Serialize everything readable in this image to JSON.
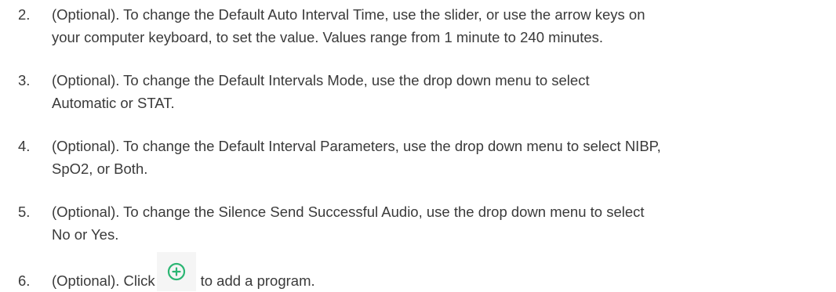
{
  "steps": [
    {
      "number": "2.",
      "lines": [
        "(Optional). To change the Default Auto Interval Time, use the slider, or use the arrow keys on",
        "your computer keyboard, to set the value. Values range from 1 minute to 240 minutes."
      ]
    },
    {
      "number": "3.",
      "lines": [
        "(Optional). To change the Default Intervals Mode, use the drop down menu to select",
        "Automatic or STAT."
      ]
    },
    {
      "number": "4.",
      "lines": [
        "(Optional). To change the Default Interval Parameters, use the drop down menu to select NIBP,",
        "SpO2, or Both."
      ]
    },
    {
      "number": "5.",
      "lines": [
        "(Optional). To change the Silence Send Successful Audio, use the drop down menu to select",
        "No or Yes."
      ]
    },
    {
      "number": "6.",
      "before_icon": "(Optional). Click",
      "after_icon": "to add a program.",
      "icon": "add-circle-icon",
      "icon_color": "#2bb673"
    }
  ]
}
